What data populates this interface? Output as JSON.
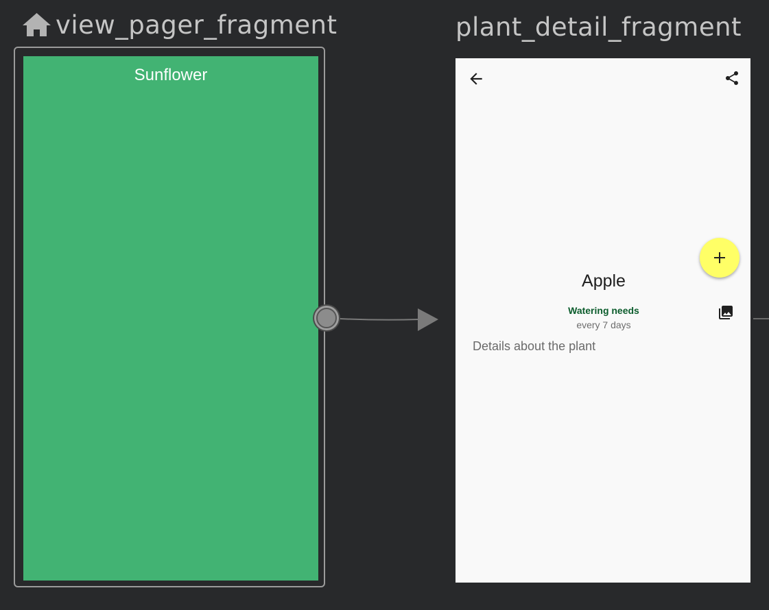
{
  "destinations": [
    {
      "id": "view_pager_fragment",
      "title": "view_pager_fragment",
      "is_start": true,
      "screen_title": "Sunflower",
      "screen_color": "#42b373"
    },
    {
      "id": "plant_detail_fragment",
      "title": "plant_detail_fragment",
      "is_start": false
    }
  ],
  "plant_detail": {
    "plant_name": "Apple",
    "watering_label": "Watering needs",
    "watering_value": "every 7 days",
    "description": "Details about the plant",
    "fab_color": "#ffff66"
  },
  "icons": {
    "start_destination": "home-icon",
    "navigate_up": "arrow-back-icon",
    "share": "share-icon",
    "fab": "plus-icon",
    "gallery": "gallery-icon"
  },
  "colors": {
    "canvas_background": "#28292b",
    "title_text": "#c5c5c5",
    "connector": "#7a7a7a"
  }
}
